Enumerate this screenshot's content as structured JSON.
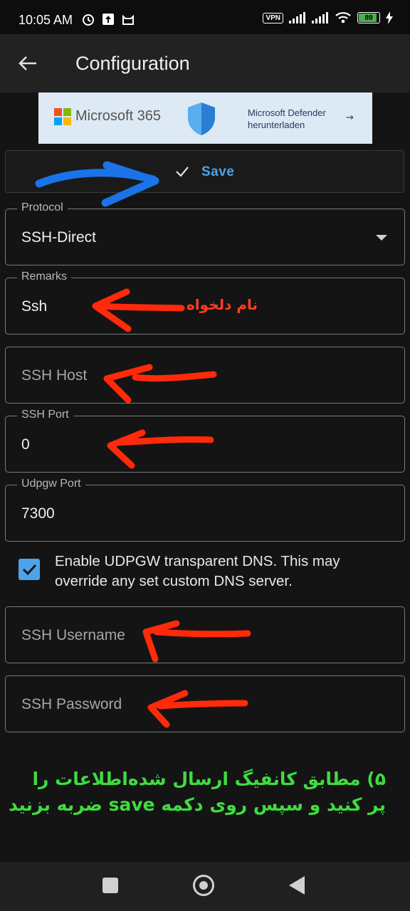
{
  "status_bar": {
    "time": "10:05 AM",
    "vpn": "VPN",
    "battery": "89",
    "battery_level": 0.89,
    "icons_left": [
      "alarm-icon",
      "upload-icon",
      "cat-notification-icon"
    ],
    "icons_right": [
      "vpn-badge",
      "signal-icon",
      "signal-icon",
      "wifi-icon",
      "battery-icon",
      "charging-icon"
    ]
  },
  "app_bar": {
    "title": "Configuration"
  },
  "ad": {
    "brand": "Microsoft 365",
    "cta_line1": "Microsoft Defender",
    "cta_line2": "herunterladen",
    "cta_arrow": "→"
  },
  "save": {
    "label": "Save"
  },
  "form": {
    "protocol": {
      "label": "Protocol",
      "value": "SSH-Direct"
    },
    "remarks": {
      "label": "Remarks",
      "value": "Ssh"
    },
    "ssh_host": {
      "placeholder": "SSH Host"
    },
    "ssh_port": {
      "label": "SSH Port",
      "value": "0"
    },
    "udpgw_port": {
      "label": "Udpgw Port",
      "value": "7300"
    },
    "udpgw_dns": {
      "text": "Enable UDPGW transparent DNS. This may override any set custom DNS server.",
      "checked": true
    },
    "ssh_username": {
      "placeholder": "SSH Username"
    },
    "ssh_password": {
      "placeholder": "SSH Password"
    }
  },
  "annotations": {
    "remarks_note": "نام دلخواه",
    "instruction": "۵) مطابق کانفیگ ارسال شده‌اطلاعات را پر کنید و سپس روی دکمه save ضربه بزنید",
    "arrow_colors": {
      "blue": "#1a73e8",
      "red": "#ff2a0a"
    }
  },
  "colors": {
    "background": "#141414",
    "accent": "#4ea3e8",
    "note_green": "#3fdc3f"
  }
}
